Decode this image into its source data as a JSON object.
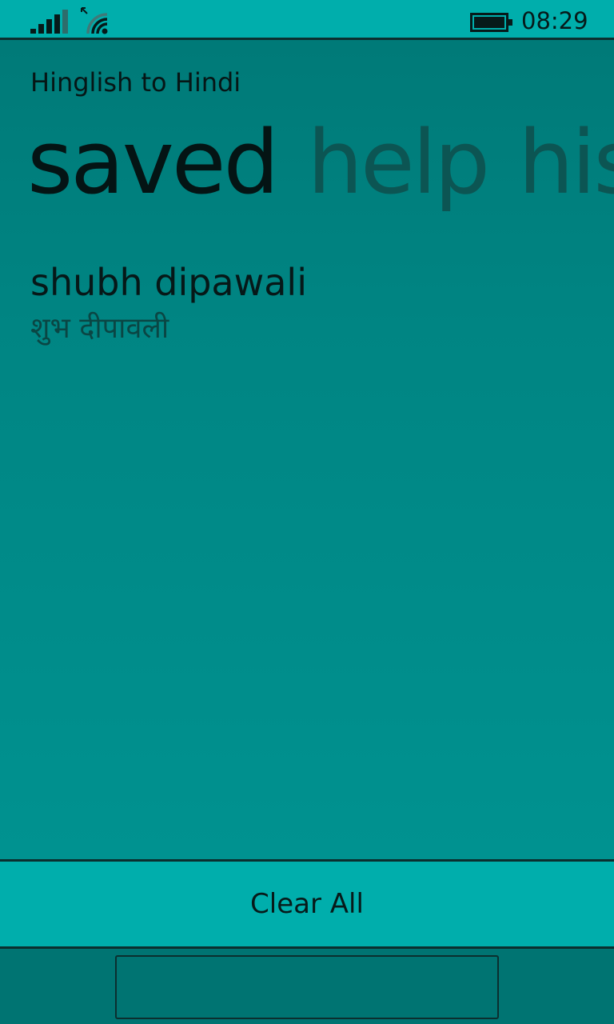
{
  "status_bar": {
    "time": "08:29",
    "icons": [
      "signal-strength-icon",
      "wifi-icon",
      "battery-icon"
    ]
  },
  "app": {
    "title": "Hinglish to Hindi"
  },
  "pivot": {
    "items": [
      {
        "label": "saved",
        "active": true
      },
      {
        "label": "help",
        "active": false
      },
      {
        "label": "history",
        "active": false
      }
    ]
  },
  "saved": {
    "entries": [
      {
        "source": "shubh dipawali",
        "translation": "शुभ दीपावली"
      }
    ]
  },
  "actions": {
    "clear_all_label": "Clear All"
  },
  "colors": {
    "accent": "#00aeac",
    "background": "#007a78",
    "border": "#0b2f2f"
  }
}
